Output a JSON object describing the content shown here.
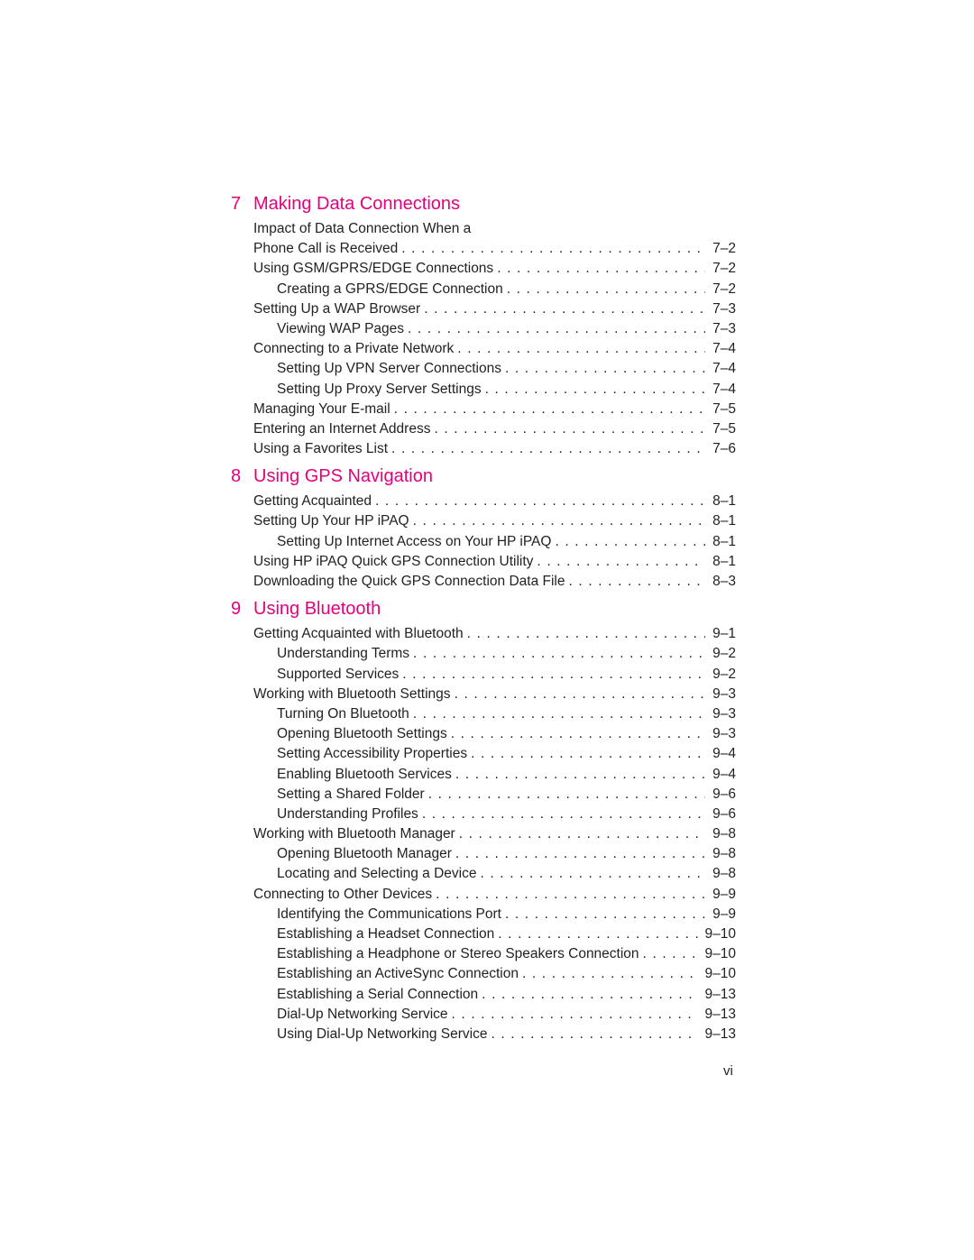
{
  "colors": {
    "heading": "#e6007e",
    "text": "#231f20"
  },
  "chapters": [
    {
      "number": "7",
      "title": "Making Data Connections",
      "entries": [
        {
          "level": 1,
          "label": "Impact of Data Connection When a",
          "page": ""
        },
        {
          "level": 1,
          "label": "Phone Call is Received",
          "page": "7–2"
        },
        {
          "level": 1,
          "label": "Using GSM/GPRS/EDGE Connections",
          "page": "7–2"
        },
        {
          "level": 2,
          "label": "Creating a GPRS/EDGE Connection",
          "page": "7–2"
        },
        {
          "level": 1,
          "label": "Setting Up a WAP Browser",
          "page": "7–3"
        },
        {
          "level": 2,
          "label": "Viewing WAP Pages",
          "page": "7–3"
        },
        {
          "level": 1,
          "label": "Connecting to a Private Network",
          "page": "7–4"
        },
        {
          "level": 2,
          "label": "Setting Up VPN Server Connections",
          "page": "7–4"
        },
        {
          "level": 2,
          "label": "Setting Up Proxy Server Settings",
          "page": "7–4"
        },
        {
          "level": 1,
          "label": "Managing Your E-mail",
          "page": "7–5"
        },
        {
          "level": 1,
          "label": "Entering an Internet Address",
          "page": "7–5"
        },
        {
          "level": 1,
          "label": "Using a Favorites List",
          "page": "7–6"
        }
      ]
    },
    {
      "number": "8",
      "title": "Using GPS Navigation",
      "entries": [
        {
          "level": 1,
          "label": "Getting Acquainted",
          "page": "8–1"
        },
        {
          "level": 1,
          "label": "Setting Up Your HP iPAQ",
          "page": "8–1"
        },
        {
          "level": 2,
          "label": "Setting Up Internet Access on Your HP iPAQ",
          "page": "8–1"
        },
        {
          "level": 1,
          "label": "Using HP iPAQ Quick GPS Connection Utility",
          "page": "8–1"
        },
        {
          "level": 1,
          "label": "Downloading the Quick GPS Connection Data File",
          "page": "8–3"
        }
      ]
    },
    {
      "number": "9",
      "title": "Using Bluetooth",
      "entries": [
        {
          "level": 1,
          "label": "Getting Acquainted with Bluetooth",
          "page": "9–1"
        },
        {
          "level": 2,
          "label": "Understanding Terms",
          "page": "9–2"
        },
        {
          "level": 2,
          "label": "Supported Services",
          "page": "9–2"
        },
        {
          "level": 1,
          "label": "Working with Bluetooth Settings",
          "page": "9–3"
        },
        {
          "level": 2,
          "label": "Turning On Bluetooth",
          "page": "9–3"
        },
        {
          "level": 2,
          "label": "Opening Bluetooth Settings",
          "page": "9–3"
        },
        {
          "level": 2,
          "label": "Setting Accessibility Properties",
          "page": "9–4"
        },
        {
          "level": 2,
          "label": "Enabling Bluetooth Services",
          "page": "9–4"
        },
        {
          "level": 2,
          "label": "Setting a Shared Folder",
          "page": "9–6"
        },
        {
          "level": 2,
          "label": "Understanding Profiles",
          "page": "9–6"
        },
        {
          "level": 1,
          "label": "Working with Bluetooth Manager",
          "page": "9–8"
        },
        {
          "level": 2,
          "label": "Opening Bluetooth Manager",
          "page": "9–8"
        },
        {
          "level": 2,
          "label": "Locating and Selecting a Device",
          "page": "9–8"
        },
        {
          "level": 1,
          "label": "Connecting to Other Devices",
          "page": "9–9"
        },
        {
          "level": 2,
          "label": "Identifying the Communications Port",
          "page": "9–9"
        },
        {
          "level": 2,
          "label": "Establishing a Headset Connection",
          "page": "9–10"
        },
        {
          "level": 2,
          "label": "Establishing a Headphone or Stereo Speakers Connection",
          "page": "9–10"
        },
        {
          "level": 2,
          "label": "Establishing an ActiveSync Connection",
          "page": "9–10"
        },
        {
          "level": 2,
          "label": "Establishing a Serial Connection",
          "page": "9–13"
        },
        {
          "level": 2,
          "label": "Dial-Up Networking Service",
          "page": "9–13"
        },
        {
          "level": 2,
          "label": "Using Dial-Up Networking Service",
          "page": "9–13"
        }
      ]
    }
  ],
  "folio": "vi"
}
